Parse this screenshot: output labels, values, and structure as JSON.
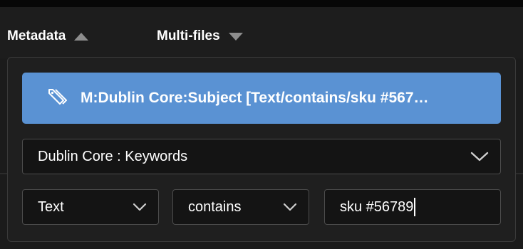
{
  "tabs": {
    "metadata_label": "Metadata",
    "multifiles_label": "Multi-files"
  },
  "filter_chip": {
    "icon": "tag-icon",
    "text": "M:Dublin Core:Subject [Text/contains/sku #567…"
  },
  "field_select": {
    "selected": "Dublin Core : Keywords"
  },
  "type_select": {
    "selected": "Text"
  },
  "operator_select": {
    "selected": "contains"
  },
  "value_input": {
    "value": "sku #56789"
  },
  "colors": {
    "accent": "#5a92d3",
    "background": "#1b1b1b",
    "panel": "#1f1f1f",
    "field": "#141414"
  }
}
